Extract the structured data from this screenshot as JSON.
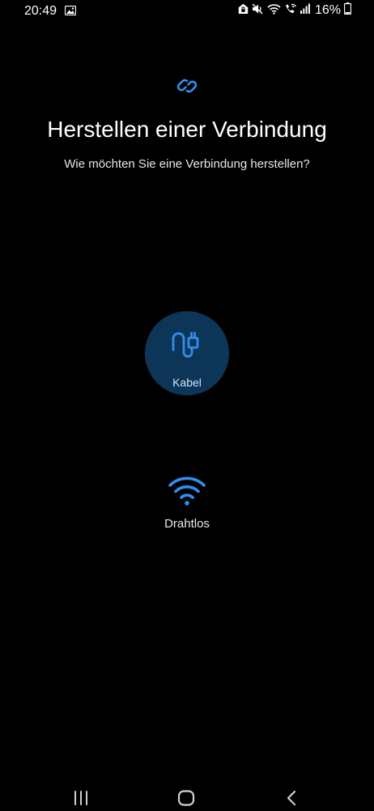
{
  "status_bar": {
    "time": "20:49",
    "battery_percent": "16%",
    "left_icons": [
      "gallery-icon"
    ],
    "right_icons": [
      "home-lock-icon",
      "mute-icon",
      "wifi-icon",
      "wifi-call-icon",
      "signal-icon",
      "battery-icon"
    ],
    "battery_level": 0.16
  },
  "header": {
    "icon": "link-icon",
    "title": "Herstellen einer Verbindung",
    "subtitle": "Wie möchten Sie eine Verbindung herstellen?"
  },
  "options": {
    "cable": {
      "icon": "usb-cable-icon",
      "label": "Kabel",
      "selected": true
    },
    "wireless": {
      "icon": "wifi-icon",
      "label": "Drahtlos",
      "selected": false
    }
  },
  "nav_bar": {
    "buttons": [
      "recent-apps-icon",
      "home-icon",
      "back-icon"
    ]
  },
  "colors": {
    "background": "#000000",
    "accent": "#2f8ff0",
    "selected_circle": "#0d3557",
    "text": "#ffffff"
  }
}
